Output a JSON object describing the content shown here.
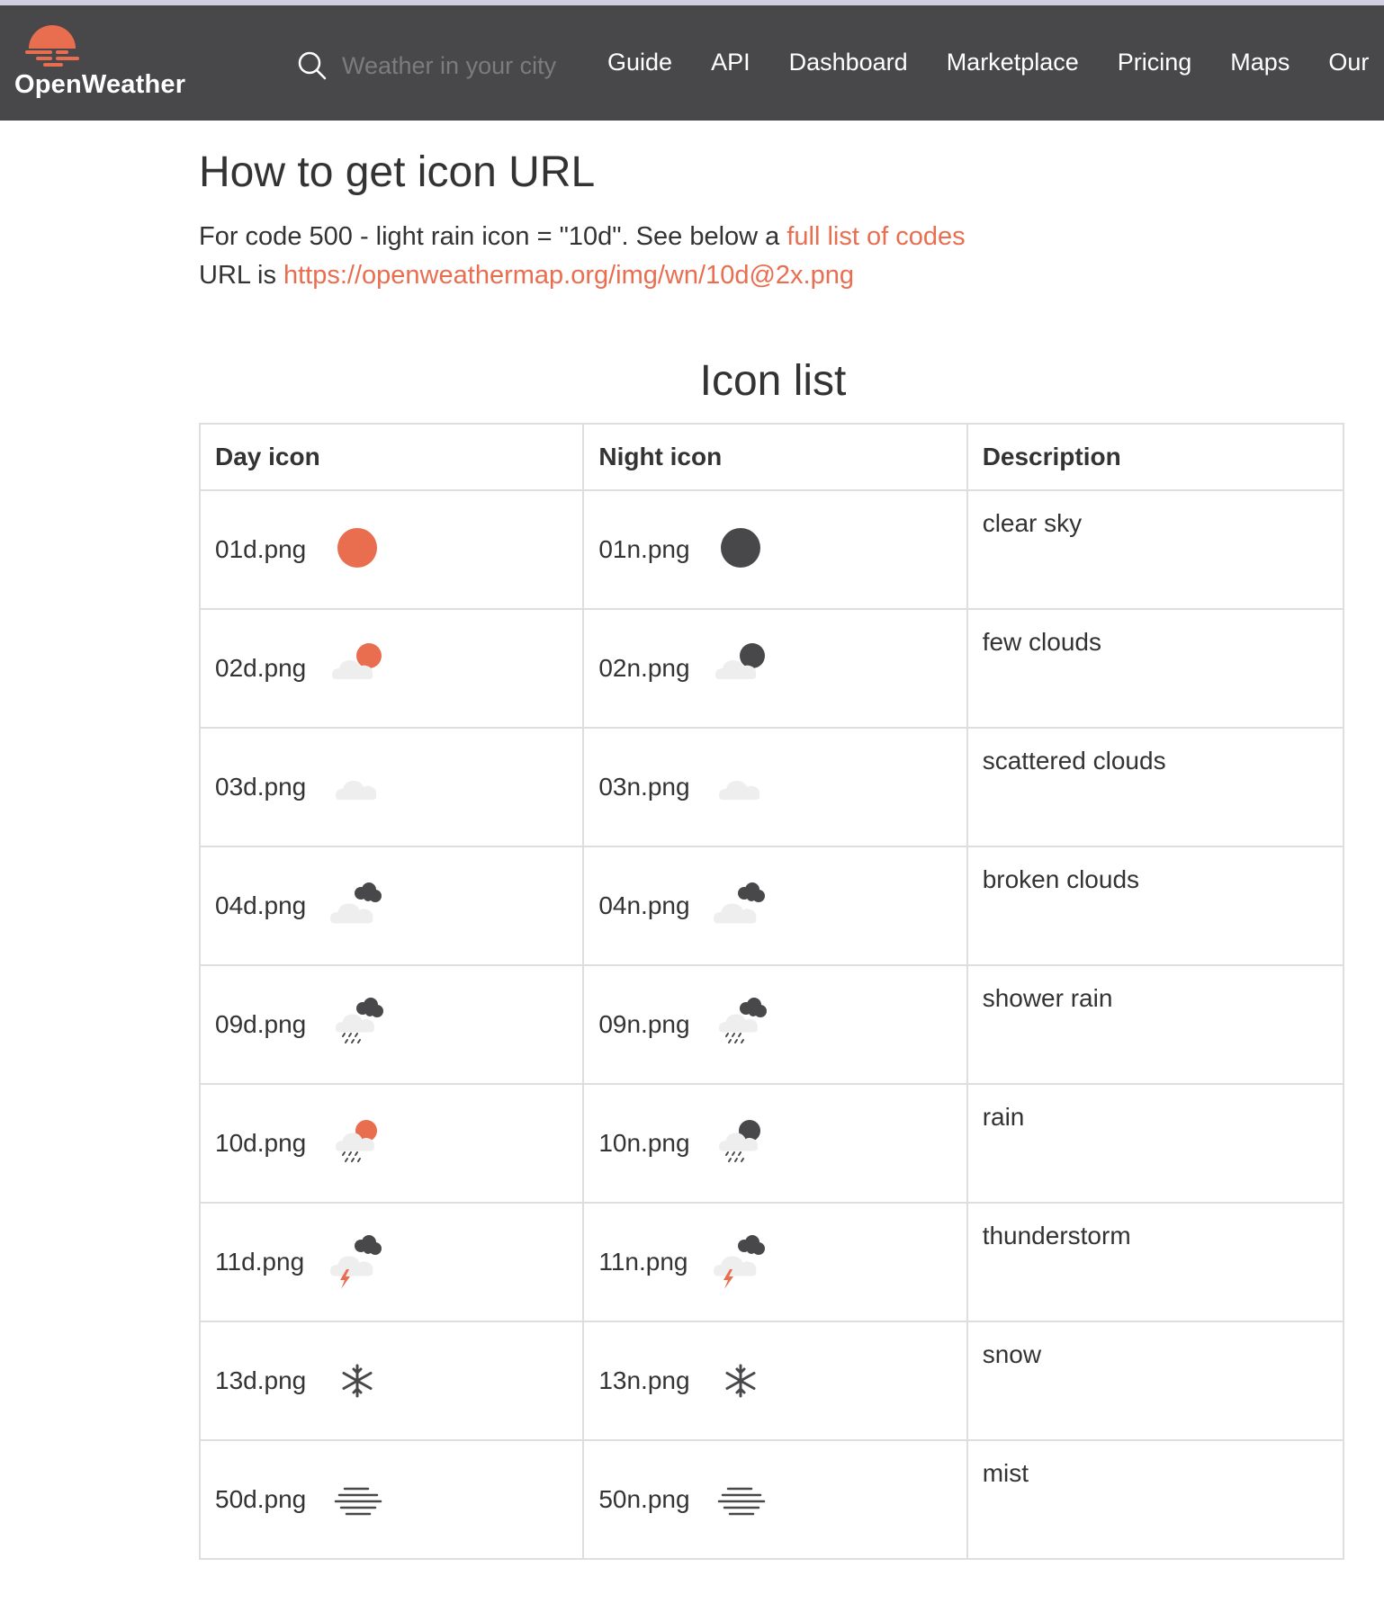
{
  "brand": {
    "name": "OpenWeather",
    "accent": "#e96e50",
    "nav_bg": "#48484a",
    "dark_icon": "#48484a",
    "light_cloud": "#eeeeee"
  },
  "search": {
    "placeholder": "Weather in your city"
  },
  "nav": {
    "items": [
      "Guide",
      "API",
      "Dashboard",
      "Marketplace",
      "Pricing",
      "Maps",
      "Our"
    ]
  },
  "heading": "How to get icon URL",
  "intro": {
    "line1_prefix": "For code 500 - light rain icon = \"10d\". See below a ",
    "line1_link": "full list of codes",
    "line2_prefix": "URL is ",
    "line2_link": "https://openweathermap.org/img/wn/10d@2x.png"
  },
  "icon_list": {
    "title": "Icon list",
    "headers": {
      "day": "Day icon",
      "night": "Night icon",
      "description": "Description"
    },
    "rows": [
      {
        "day": "01d.png",
        "night": "01n.png",
        "description": "clear sky",
        "icon": "clear-sky"
      },
      {
        "day": "02d.png",
        "night": "02n.png",
        "description": "few clouds",
        "icon": "few-clouds"
      },
      {
        "day": "03d.png",
        "night": "03n.png",
        "description": "scattered clouds",
        "icon": "scattered-clouds"
      },
      {
        "day": "04d.png",
        "night": "04n.png",
        "description": "broken clouds",
        "icon": "broken-clouds"
      },
      {
        "day": "09d.png",
        "night": "09n.png",
        "description": "shower rain",
        "icon": "shower-rain"
      },
      {
        "day": "10d.png",
        "night": "10n.png",
        "description": "rain",
        "icon": "rain"
      },
      {
        "day": "11d.png",
        "night": "11n.png",
        "description": "thunderstorm",
        "icon": "thunderstorm"
      },
      {
        "day": "13d.png",
        "night": "13n.png",
        "description": "snow",
        "icon": "snow"
      },
      {
        "day": "50d.png",
        "night": "50n.png",
        "description": "mist",
        "icon": "mist"
      }
    ]
  }
}
